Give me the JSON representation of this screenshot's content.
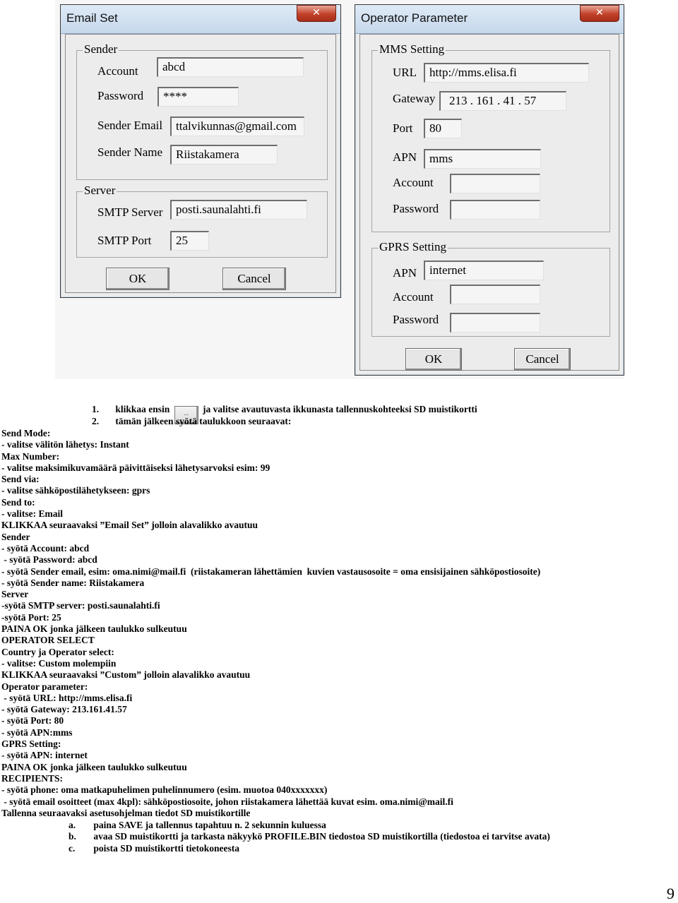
{
  "email_set": {
    "title": "Email Set",
    "close_icon": "close-x-icon",
    "sender_group": "Sender",
    "account_label": "Account",
    "account_value": "abcd",
    "password_label": "Password",
    "password_value": "****",
    "sender_email_label": "Sender Email",
    "sender_email_value": "ttalvikunnas@gmail.com",
    "sender_name_label": "Sender Name",
    "sender_name_value": "Riistakamera",
    "server_group": "Server",
    "smtp_server_label": "SMTP Server",
    "smtp_server_value": "posti.saunalahti.fi",
    "smtp_port_label": "SMTP Port",
    "smtp_port_value": "25",
    "ok_label": "OK",
    "cancel_label": "Cancel"
  },
  "operator_parameter": {
    "title": "Operator Parameter",
    "close_icon": "close-x-icon",
    "mms_group": "MMS Setting",
    "url_label": "URL",
    "url_value": "http://mms.elisa.fi",
    "gateway_label": "Gateway",
    "gateway_value": "213 . 161 . 41 . 57",
    "port_label": "Port",
    "port_value": "80",
    "apn_label": "APN",
    "apn_value": "mms",
    "account_label": "Account",
    "account_value": "",
    "password_label": "Password",
    "password_value": "",
    "gprs_group": "GPRS Setting",
    "gprs_apn_label": "APN",
    "gprs_apn_value": "internet",
    "gprs_account_label": "Account",
    "gprs_account_value": "",
    "gprs_password_label": "Password",
    "gprs_password_value": "",
    "ok_label": "OK",
    "cancel_label": "Cancel"
  },
  "steps": [
    {
      "num": "1.",
      "before": "klikkaa ensin",
      "button": "...",
      "after": "ja valitse avautuvasta ikkunasta tallennuskohteeksi SD muistikortti"
    },
    {
      "num": "2.",
      "text": "tämän jälkeen syötä taulukkoon seuraavat:"
    }
  ],
  "lines": [
    "Send Mode:",
    "- valitse välitön lähetys: Instant",
    "Max Number:",
    "- valitse maksimikuvamäärä päivittäiseksi lähetysarvoksi esim: 99",
    "Send via:",
    "- valitse sähköpostilähetykseen: gprs",
    "Send to:",
    "- valitse: Email",
    "KLIKKAA seuraavaksi ”Email Set” jolloin alavalikko avautuu",
    "Sender",
    "- syötä Account: abcd",
    " - syötä Password: abcd",
    "- syötä Sender email, esim: oma.nimi@mail.fi  (riistakameran lähettämien  kuvien vastausosoite = oma ensisijainen sähköpostiosoite)",
    "- syötä Sender name: Riistakamera",
    "Server",
    "-syötä SMTP server: posti.saunalahti.fi",
    "-syötä Port: 25",
    "PAINA OK jonka jälkeen taulukko sulkeutuu",
    "OPERATOR SELECT",
    "Country ja Operator select:",
    "- valitse: Custom molempiin",
    "KLIKKAA seuraavaksi ”Custom” jolloin alavalikko avautuu",
    "Operator parameter:",
    " - syötä URL: http://mms.elisa.fi",
    "- syötä Gateway: 213.161.41.57",
    "- syötä Port: 80",
    "- syötä APN:mms",
    "GPRS Setting:",
    "- syötä APN: internet",
    "PAINA OK jonka jälkeen taulukko sulkeutuu",
    "RECIPIENTS:",
    "- syötä phone: oma matkapuhelimen puhelinnumero (esim. muotoa 040xxxxxxx)",
    " - syötä email osoitteet (max 4kpl): sähköpostiosoite, johon riistakamera lähettää kuvat esim. oma.nimi@mail.fi",
    "Tallenna seuraavaksi asetusohjelman tiedot SD muistikortille"
  ],
  "sub_steps": [
    {
      "letter": "a.",
      "text": "paina SAVE ja tallennus tapahtuu n. 2 sekunnin kuluessa"
    },
    {
      "letter": "b.",
      "text": "avaa SD muistikortti ja tarkasta näkyykö PROFILE.BIN tiedostoa SD muistikortilla (tiedostoa ei tarvitse avata)"
    },
    {
      "letter": "c.",
      "text": "poista SD muistikortti tietokoneesta"
    }
  ],
  "page_number": "9"
}
